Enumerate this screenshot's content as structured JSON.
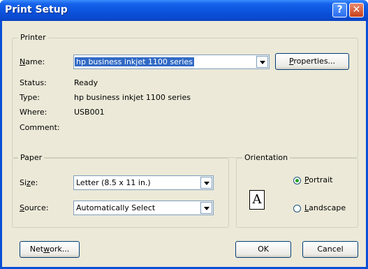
{
  "window": {
    "title": "Print Setup",
    "help_icon": "?",
    "close_icon": "✕"
  },
  "printer": {
    "legend": "Printer",
    "name_label": "Name:",
    "name_value": "hp business inkjet 1100 series",
    "properties_button": "Properties...",
    "status_label": "Status:",
    "status_value": "Ready",
    "type_label": "Type:",
    "type_value": "hp business inkjet 1100 series",
    "where_label": "Where:",
    "where_value": "USB001",
    "comment_label": "Comment:",
    "comment_value": ""
  },
  "paper": {
    "legend": "Paper",
    "size_label": "Size:",
    "size_value": "Letter (8.5 x 11 in.)",
    "source_label": "Source:",
    "source_value": "Automatically Select"
  },
  "orientation": {
    "legend": "Orientation",
    "icon_letter": "A",
    "portrait_label": "Portrait",
    "landscape_label": "Landscape",
    "selected": "Portrait"
  },
  "buttons": {
    "network": "Network...",
    "ok": "OK",
    "cancel": "Cancel"
  }
}
